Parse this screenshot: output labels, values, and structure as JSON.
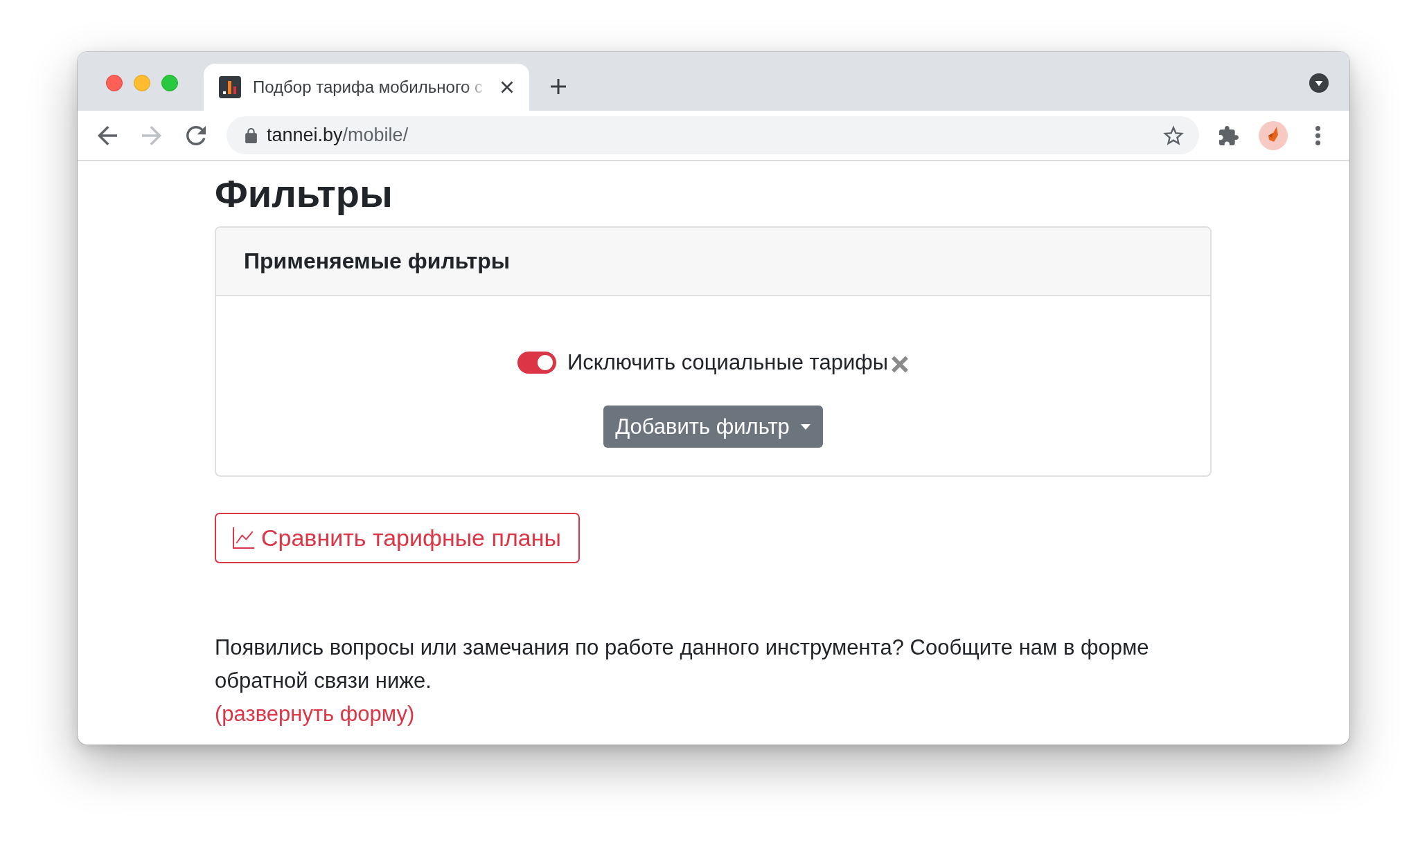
{
  "window": {
    "tabs": [
      {
        "title": "Подбор тарифа мобильного с",
        "selected": true
      }
    ],
    "nav_buttons": [
      {
        "kind": "back",
        "disabled": false
      },
      {
        "kind": "forward",
        "disabled": true
      },
      {
        "kind": "reload",
        "disabled": false
      }
    ],
    "address": {
      "host": "tannei.by",
      "path": "/mobile/"
    }
  },
  "page": {
    "heading": "Фильтры",
    "filters_card": {
      "title": "Применяемые фильтры",
      "filters": [
        {
          "label": "Исключить социальные тарифы",
          "on": true
        }
      ],
      "add_button": "Добавить фильтр"
    },
    "compare_button": "Сравнить тарифные планы",
    "feedback": {
      "text": "Появились вопросы или замечания по работе данного инструмента? Сообщите нам в форме обратной связи ниже.",
      "link": "(развернуть форму)"
    }
  }
}
